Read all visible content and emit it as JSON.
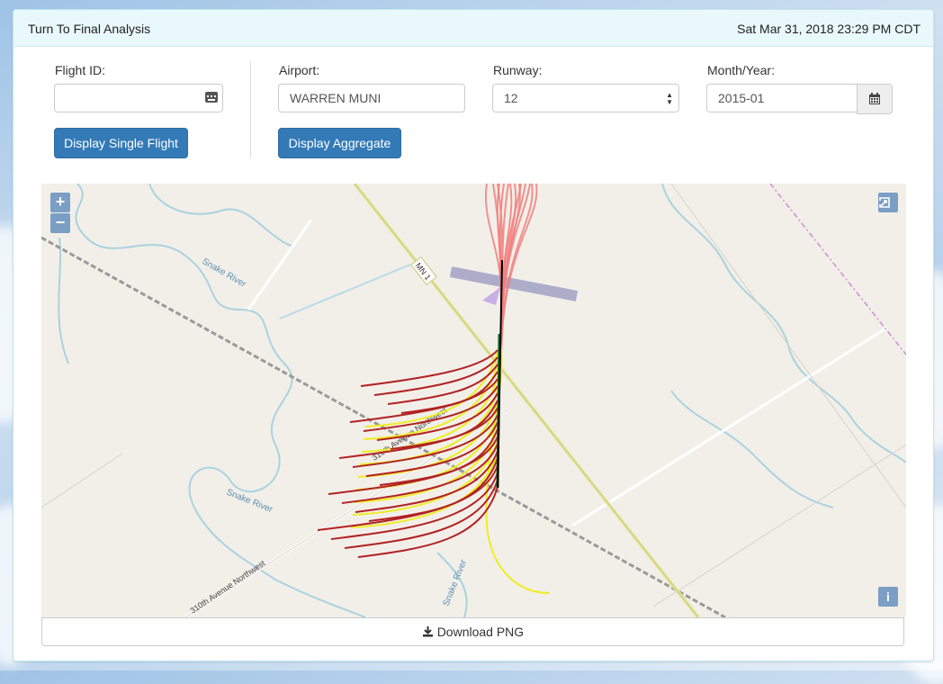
{
  "header": {
    "title": "Turn To Final Analysis",
    "datetime": "Sat Mar 31, 2018 23:29 PM CDT"
  },
  "form": {
    "flight_id": {
      "label": "Flight ID:",
      "value": ""
    },
    "airport": {
      "label": "Airport:",
      "value": "WARREN MUNI"
    },
    "runway": {
      "label": "Runway:",
      "value": "12"
    },
    "month_year": {
      "label": "Month/Year:",
      "value": "2015-01"
    },
    "display_single_label": "Display Single Flight",
    "display_aggregate_label": "Display Aggregate"
  },
  "map": {
    "zoom_in": "+",
    "zoom_out": "−",
    "info": "i",
    "road_labels": [
      "MN 1",
      "310th Avenue Northwest",
      "310th Avenue Northwest"
    ],
    "river_labels": [
      "Snake River",
      "Snake River",
      "Snake River"
    ],
    "colors": {
      "failed_turn": "#b22222",
      "marginal_turn": "#eeee22",
      "approach": "#f08080",
      "runway": "#a9a9c8",
      "centerline": "#000000"
    }
  },
  "download": {
    "icon": "download-icon",
    "label": "Download PNG"
  }
}
